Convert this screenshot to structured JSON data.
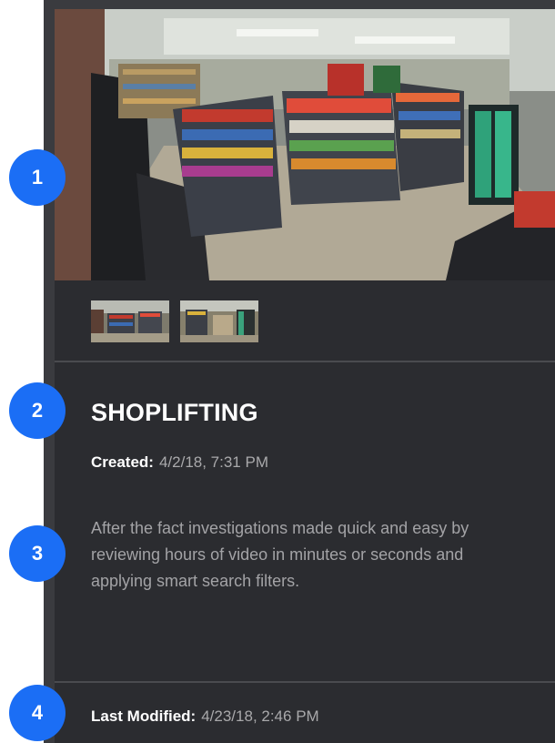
{
  "card": {
    "title": "SHOPLIFTING",
    "created_label": "Created:",
    "created_value": "4/2/18, 7:31 PM",
    "description": "After the fact investigations made quick and easy by reviewing hours of video in minutes or seconds and applying smart search filters.",
    "modified_label": "Last Modified:",
    "modified_value": "4/23/18, 2:46 PM"
  },
  "badges": [
    "1",
    "2",
    "3",
    "4"
  ],
  "thumbnails": [
    "camera-thumbnail-1",
    "camera-thumbnail-2"
  ],
  "colors": {
    "panel": "#2b2c30",
    "badge": "#1b6ef5",
    "title": "#ffffff",
    "muted_text": "#a3a3a6"
  }
}
